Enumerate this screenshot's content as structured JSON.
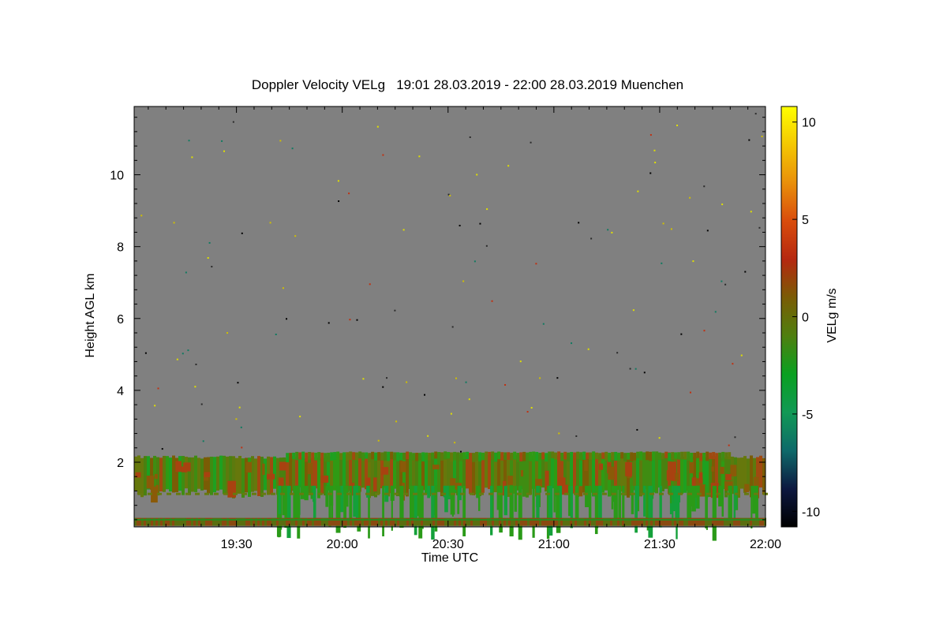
{
  "chart_data": {
    "type": "heatmap",
    "title": "Doppler Velocity VELg   19:01 28.03.2019 - 22:00 28.03.2019 Muenchen",
    "xlabel": "Time UTC",
    "ylabel": "Height AGL km",
    "colorbar_label": "VELg m/s",
    "x_ticks": [
      "19:30",
      "20:00",
      "20:30",
      "21:00",
      "21:30",
      "22:00"
    ],
    "x_tick_minutes": [
      1170,
      1200,
      1230,
      1260,
      1290,
      1320
    ],
    "xlim_minutes": [
      1141,
      1320
    ],
    "y_ticks": [
      2,
      4,
      6,
      8,
      10
    ],
    "ylim": [
      0.2,
      11.9
    ],
    "colorbar_ticks": [
      10,
      5,
      0,
      -5,
      -10
    ],
    "colorbar_range": [
      -10.8,
      10.8
    ],
    "colorscale": [
      "#000000",
      "#0d1840",
      "#0e6a6a",
      "#119955",
      "#0aa020",
      "#4f7f0f",
      "#7a5c05",
      "#b52810",
      "#d94c0c",
      "#e98f0a",
      "#f4c702",
      "#ffff00"
    ],
    "background_color": "#808080",
    "grid": false,
    "data_description": {
      "boundary_layer_top_km": 2.1,
      "boundary_layer_base_km": 1.3,
      "elevated_layer_km": [
        2.05,
        2.3
      ],
      "elevated_layer_time_span": [
        "19:44",
        "21:50"
      ]
    }
  }
}
